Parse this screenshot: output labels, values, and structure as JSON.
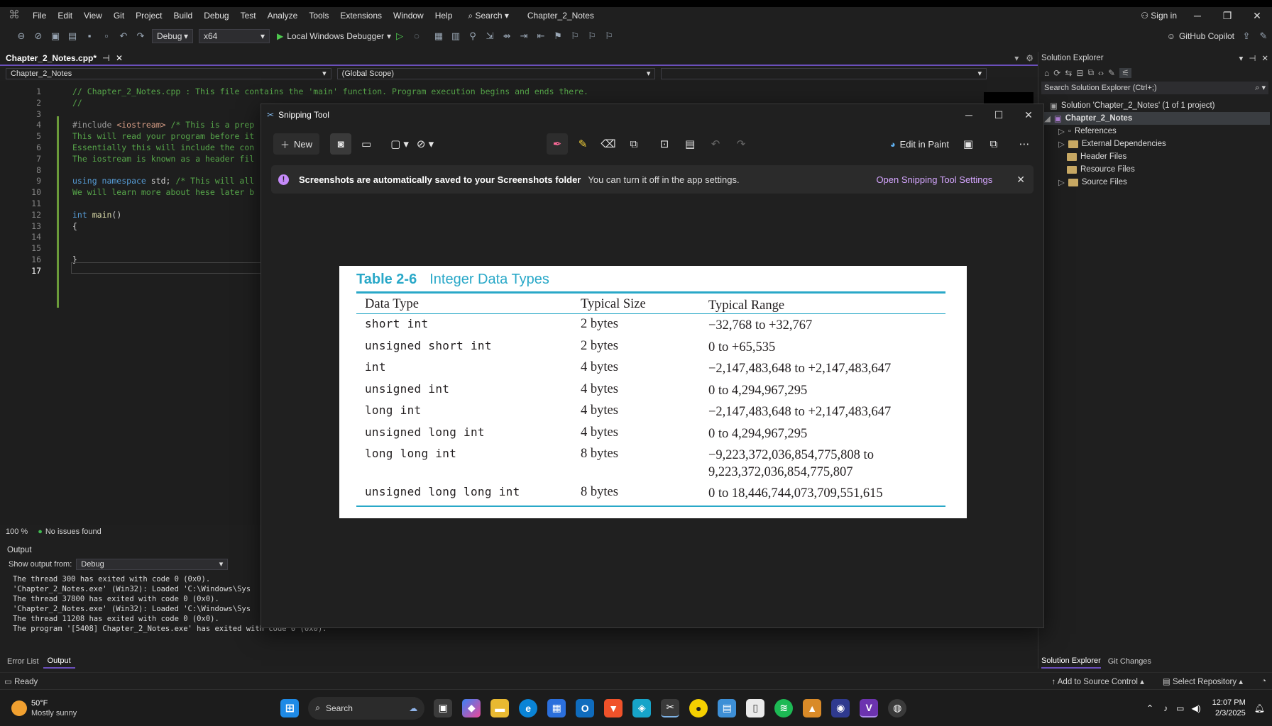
{
  "menu": {
    "items": [
      "File",
      "Edit",
      "View",
      "Git",
      "Project",
      "Build",
      "Debug",
      "Test",
      "Analyze",
      "Tools",
      "Extensions",
      "Window",
      "Help"
    ],
    "search": "Search",
    "solution_name": "Chapter_2_Notes",
    "sign_in": "Sign in"
  },
  "toolbar": {
    "config": "Debug",
    "platform": "x64",
    "run_label": "Local Windows Debugger",
    "copilot": "GitHub Copilot"
  },
  "editor": {
    "tab_title": "Chapter_2_Notes.cpp*",
    "nav_project": "Chapter_2_Notes",
    "nav_scope": "(Global Scope)",
    "zoom": "100 %",
    "issues": "No issues found",
    "lines": [
      {
        "n": "1",
        "html": "<span class='cm'>// Chapter_2_Notes.cpp : This file contains the 'main' function. Program execution begins and ends there.</span>"
      },
      {
        "n": "2",
        "html": "<span class='cm'>//</span>"
      },
      {
        "n": "3",
        "html": ""
      },
      {
        "n": "4",
        "html": "<span class='pp'>#include</span> <span class='inc'>&lt;iostream&gt;</span> <span class='cm'>/* This is a prep</span>"
      },
      {
        "n": "5",
        "html": "<span class='cm'>This will read your program before it</span>"
      },
      {
        "n": "6",
        "html": "<span class='cm'>Essentially this will include the con</span>"
      },
      {
        "n": "7",
        "html": "<span class='cm'>The iostream is known as a header fil</span>"
      },
      {
        "n": "8",
        "html": ""
      },
      {
        "n": "9",
        "html": "<span class='kw'>using namespace</span> std; <span class='cm'>/* This will all</span>"
      },
      {
        "n": "10",
        "html": "<span class='cm'>We will learn more about hese later b</span>"
      },
      {
        "n": "11",
        "html": ""
      },
      {
        "n": "12",
        "html": "<span class='kw'>int</span> <span class='fn'>main</span>()"
      },
      {
        "n": "13",
        "html": "{"
      },
      {
        "n": "14",
        "html": ""
      },
      {
        "n": "15",
        "html": ""
      },
      {
        "n": "16",
        "html": "}"
      },
      {
        "n": "17",
        "html": ""
      }
    ]
  },
  "output": {
    "title": "Output",
    "show_from_label": "Show output from:",
    "source": "Debug",
    "lines": [
      "The thread 300 has exited with code 0 (0x0).",
      "'Chapter_2_Notes.exe' (Win32): Loaded 'C:\\Windows\\Sys",
      "The thread 37800 has exited with code 0 (0x0).",
      "'Chapter_2_Notes.exe' (Win32): Loaded 'C:\\Windows\\Sys",
      "The thread 11208 has exited with code 0 (0x0).",
      "The program '[5408] Chapter_2_Notes.exe' has exited with code 0 (0x0)."
    ],
    "tabs": [
      "Error List",
      "Output"
    ]
  },
  "status": {
    "ready": "Ready",
    "source_control": "Add to Source Control",
    "repository": "Select Repository"
  },
  "solution_explorer": {
    "title": "Solution Explorer",
    "search": "Search Solution Explorer (Ctrl+;)",
    "solution": "Solution 'Chapter_2_Notes' (1 of 1 project)",
    "project": "Chapter_2_Notes",
    "nodes": [
      "References",
      "External Dependencies",
      "Header Files",
      "Resource Files",
      "Source Files"
    ],
    "bottom_tabs": [
      "Solution Explorer",
      "Git Changes"
    ]
  },
  "snipping": {
    "title": "Snipping Tool",
    "new": "New",
    "edit_in_paint": "Edit in Paint",
    "banner_bold": "Screenshots are automatically saved to your Screenshots folder",
    "banner_text": "You can turn it off in the app settings.",
    "banner_link": "Open Snipping Tool Settings"
  },
  "table": {
    "number": "Table 2-6",
    "title": "Integer Data Types",
    "headers": [
      "Data Type",
      "Typical Size",
      "Typical Range"
    ],
    "rows": [
      {
        "type": "short int",
        "size": "2 bytes",
        "range": "−32,768 to +32,767"
      },
      {
        "type": "unsigned short int",
        "size": "2 bytes",
        "range": "0 to +65,535"
      },
      {
        "type": "int",
        "size": "4 bytes",
        "range": "−2,147,483,648 to +2,147,483,647"
      },
      {
        "type": "unsigned int",
        "size": "4 bytes",
        "range": "0 to 4,294,967,295"
      },
      {
        "type": "long int",
        "size": "4 bytes",
        "range": "−2,147,483,648 to +2,147,483,647"
      },
      {
        "type": "unsigned long int",
        "size": "4 bytes",
        "range": "0 to 4,294,967,295"
      },
      {
        "type": "long long int",
        "size": "8 bytes",
        "range": "−9,223,372,036,854,775,808 to",
        "range2": "9,223,372,036,854,775,807"
      },
      {
        "type": "unsigned long long int",
        "size": "8 bytes",
        "range": "0 to 18,446,744,073,709,551,615"
      }
    ]
  },
  "taskbar": {
    "temp": "50°F",
    "weather": "Mostly sunny",
    "search": "Search",
    "time": "12:07 PM",
    "date": "2/3/2025"
  },
  "colors": {
    "accent": "#6b4fbb",
    "table_blue": "#29a8c8"
  }
}
